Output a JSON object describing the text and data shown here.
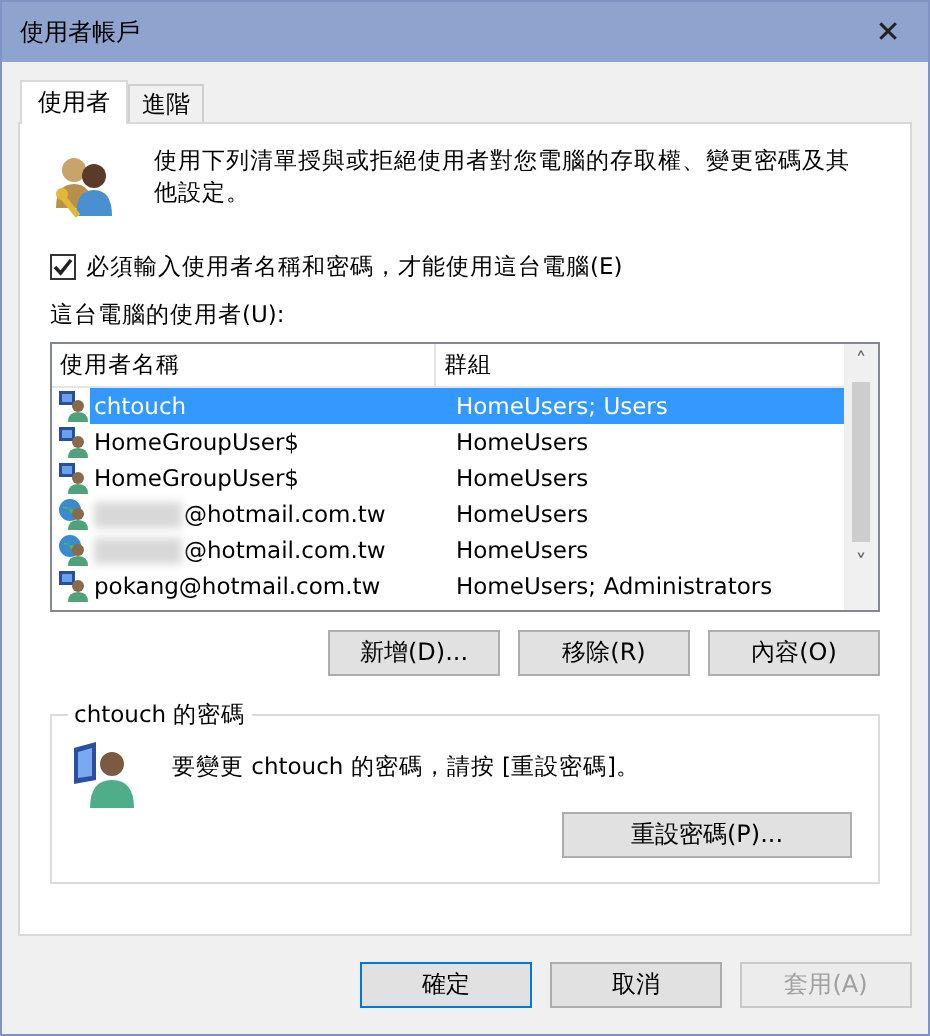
{
  "window": {
    "title": "使用者帳戶",
    "close": "✕"
  },
  "tabs": [
    {
      "label": "使用者",
      "selected": true
    },
    {
      "label": "進階",
      "selected": false
    }
  ],
  "intro": "使用下列清單授與或拒絕使用者對您電腦的存取權、變更密碼及其他設定。",
  "require_login": {
    "label": "必須輸入使用者名稱和密碼，才能使用這台電腦(E)",
    "checked": true
  },
  "users_label": "這台電腦的使用者(U):",
  "table": {
    "columns": [
      "使用者名稱",
      "群組"
    ],
    "rows": [
      {
        "kind": "local",
        "name": "chtouch",
        "group": "HomeUsers; Users",
        "selected": true,
        "redacted": false
      },
      {
        "kind": "local",
        "name": "HomeGroupUser$",
        "group": "HomeUsers",
        "selected": false,
        "redacted": false
      },
      {
        "kind": "local",
        "name": "HomeGroupUser$",
        "group": "HomeUsers",
        "selected": false,
        "redacted": false
      },
      {
        "kind": "online",
        "name": "@hotmail.com.tw",
        "group": "HomeUsers",
        "selected": false,
        "redacted": true
      },
      {
        "kind": "online",
        "name": "@hotmail.com.tw",
        "group": "HomeUsers",
        "selected": false,
        "redacted": true
      },
      {
        "kind": "local",
        "name": "pokang@hotmail.com.tw",
        "group": "HomeUsers; Administrators",
        "selected": false,
        "redacted": false
      }
    ],
    "scroll_up": "˄",
    "scroll_down": "˅"
  },
  "list_buttons": [
    "新增(D)...",
    "移除(R)",
    "內容(O)"
  ],
  "password_group": {
    "title": "chtouch 的密碼",
    "text": "要變更 chtouch 的密碼，請按 [重設密碼]。",
    "button": "重設密碼(P)..."
  },
  "buttons": [
    {
      "label": "確定",
      "default": true,
      "disabled": false
    },
    {
      "label": "取消",
      "default": false,
      "disabled": false
    },
    {
      "label": "套用(A)",
      "default": false,
      "disabled": true
    }
  ]
}
